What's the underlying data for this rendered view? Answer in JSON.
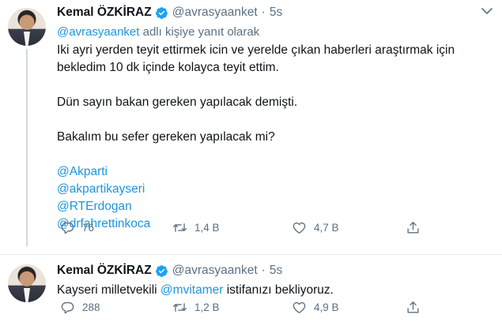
{
  "tweets": [
    {
      "author": "Kemal ÖZKİRAZ",
      "handle": "@avrasyaanket",
      "separator": "·",
      "time": "5s",
      "reply_mention": "@avrasyaanket",
      "reply_suffix": " adlı kişiye yanıt olarak",
      "paragraphs": [
        "Iki ayri yerden teyit ettirmek icin ve yerelde çıkan haberleri araştırmak için bekledim 10 dk içinde kolayca teyit ettim.",
        "Dün sayın bakan gereken yapılacak demişti.",
        "Bakalım bu sefer gereken yapılacak mi?"
      ],
      "mentions": [
        "@Akparti",
        "@akpartikayseri",
        "@RTErdogan",
        "@drfahrettinkoca"
      ],
      "replies": "76",
      "retweets": "1,4 B",
      "likes": "4,7 B"
    },
    {
      "author": "Kemal ÖZKİRAZ",
      "handle": "@avrasyaanket",
      "separator": "·",
      "time": "5s",
      "text_before": "Kayseri milletvekili ",
      "text_mention": "@mvitamer",
      "text_after": " istifanızı bekliyoruz.",
      "replies": "288",
      "retweets": "1,2 B",
      "likes": "4,9 B"
    }
  ],
  "icons": {
    "verified": "verified-badge-icon",
    "reply": "reply-icon",
    "retweet": "retweet-icon",
    "like": "heart-icon",
    "share": "share-icon",
    "caret": "chevron-down-icon"
  },
  "colors": {
    "link": "#1b95e0",
    "muted": "#5b7083",
    "verified": "#1da1f2"
  }
}
